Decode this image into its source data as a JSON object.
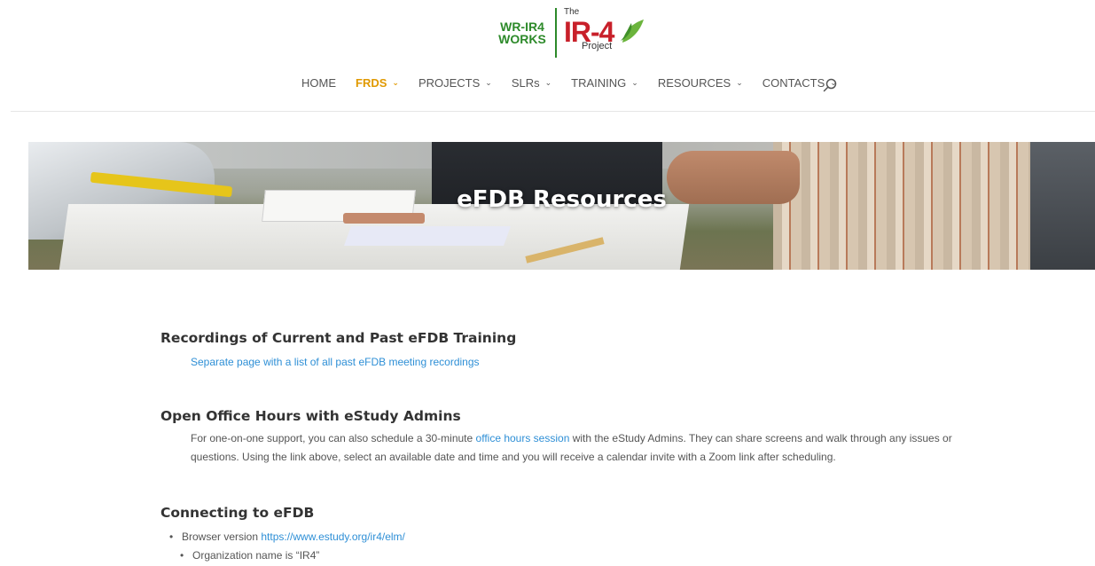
{
  "logo": {
    "wr_line1": "WR-IR4",
    "wr_line2": "WORKS",
    "the": "The",
    "main": "IR-4",
    "project": "Project"
  },
  "nav": {
    "items": [
      {
        "label": "HOME",
        "dropdown": false
      },
      {
        "label": "FRDs",
        "dropdown": true,
        "active": true
      },
      {
        "label": "PROJECTS",
        "dropdown": true
      },
      {
        "label": "SLRs",
        "dropdown": true
      },
      {
        "label": "TRAINING",
        "dropdown": true
      },
      {
        "label": "RESOURCES",
        "dropdown": true
      },
      {
        "label": "CONTACTS",
        "dropdown": true
      }
    ],
    "search_icon": "search-icon"
  },
  "hero": {
    "title": "eFDB Resources"
  },
  "sections": {
    "recordings": {
      "heading": "Recordings of Current and Past eFDB Training",
      "link": "Separate page with a list of all past eFDB meeting recordings"
    },
    "office_hours": {
      "heading": "Open Office Hours with eStudy Admins",
      "text_before": "For one-on-one support, you can also schedule a 30-minute ",
      "link": "office hours session",
      "text_after": " with the eStudy Admins. They can share screens and walk through any issues or questions. Using the link above, select an available date and time and you will receive a calendar invite with a Zoom link after scheduling."
    },
    "connecting": {
      "heading": "Connecting to eFDB",
      "browser_label": "Browser version ",
      "browser_link": "https://www.estudy.org/ir4/elm/",
      "org_name": "Organization name is “IR4”"
    }
  },
  "colors": {
    "accent": "#e09900",
    "link": "#2e8fd6",
    "brand_green": "#2d8a2a",
    "brand_red": "#c8202a"
  }
}
